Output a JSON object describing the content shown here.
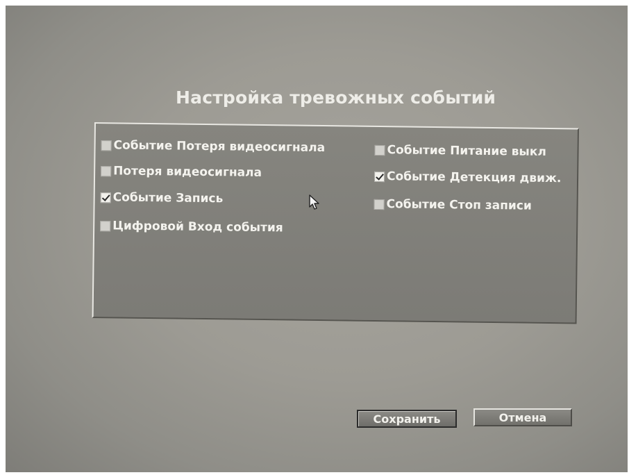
{
  "dialog": {
    "title": "Настройка тревожных событий"
  },
  "events": {
    "left": [
      {
        "label": "Событие Потеря видеосигнала",
        "checked": false
      },
      {
        "label": "Потеря видеосигнала",
        "checked": false
      },
      {
        "label": "Событие Запись",
        "checked": true
      },
      {
        "label": "Цифровой Вход события",
        "checked": false
      }
    ],
    "right": [
      {
        "label": "Событие Питание выкл",
        "checked": false
      },
      {
        "label": "Событие Детекция движ.",
        "checked": true
      },
      {
        "label": "Событие Стоп записи",
        "checked": false
      }
    ]
  },
  "buttons": {
    "save_label": "Сохранить",
    "cancel_label": "Отмена"
  },
  "icons": {
    "pointer": "mouse-pointer-icon"
  },
  "colors": {
    "background": "#9d9b94",
    "panel": "#7e7d78",
    "text": "#f4f3ee"
  }
}
